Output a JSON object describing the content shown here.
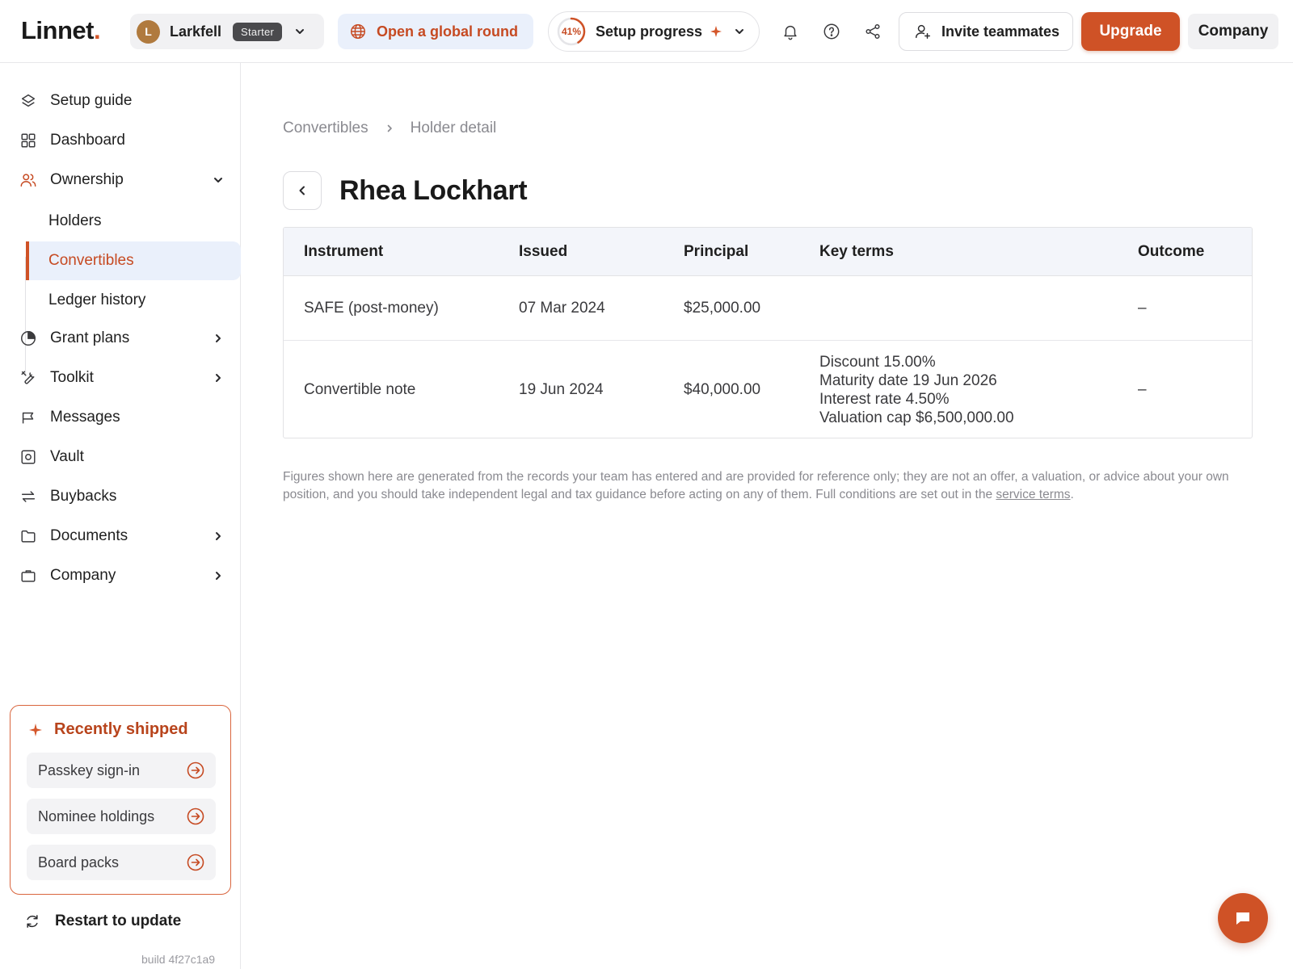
{
  "brand": {
    "name": "Linnet",
    "dot": ".",
    "accent": "#cf5226"
  },
  "header": {
    "org": {
      "initial": "L",
      "name": "Larkfell",
      "plan": "Starter"
    },
    "global_round_label": "Open a global round",
    "setup": {
      "percent_label": "41%",
      "percent": 0.41,
      "label": "Setup progress"
    },
    "invite_label": "Invite teammates",
    "upgrade_label": "Upgrade",
    "company_label": "Company",
    "icons": [
      "bell-icon",
      "help-icon",
      "share-icon"
    ]
  },
  "sidebar": {
    "items": [
      {
        "label": "Setup guide",
        "icon": "setup-guide-icon"
      },
      {
        "label": "Dashboard",
        "icon": "dashboard-icon"
      },
      {
        "label": "Ownership",
        "icon": "people-icon",
        "expanded": true
      },
      {
        "label": "Grant plans",
        "icon": "pie-icon"
      },
      {
        "label": "Toolkit",
        "icon": "tools-icon"
      },
      {
        "label": "Messages",
        "icon": "flag-icon"
      },
      {
        "label": "Vault",
        "icon": "vault-icon"
      },
      {
        "label": "Buybacks",
        "icon": "swap-icon"
      },
      {
        "label": "Documents",
        "icon": "folder-icon"
      },
      {
        "label": "Company",
        "icon": "briefcase-icon"
      }
    ],
    "ownership_children": [
      {
        "label": "Holders"
      },
      {
        "label": "Convertibles",
        "active": true
      },
      {
        "label": "Ledger history"
      }
    ],
    "shipped": {
      "title": "Recently shipped",
      "items": [
        "Passkey sign-in",
        "Nominee holdings",
        "Board packs"
      ]
    },
    "restart_label": "Restart to update",
    "build_label": "build 4f27c1a9"
  },
  "main": {
    "breadcrumb": [
      "Convertibles",
      "Holder detail"
    ],
    "title": "Rhea Lockhart",
    "table": {
      "columns": [
        "Instrument",
        "Issued",
        "Principal",
        "Key terms",
        "Outcome"
      ],
      "rows": [
        {
          "instrument": "SAFE (post-money)",
          "issued": "07 Mar 2024",
          "principal": "$25,000.00",
          "terms": [],
          "outcome": "–"
        },
        {
          "instrument": "Convertible note",
          "issued": "19 Jun 2024",
          "principal": "$40,000.00",
          "terms": [
            "Discount 15.00%",
            "Maturity date 19 Jun 2026",
            "Interest rate 4.50%",
            "Valuation cap $6,500,000.00"
          ],
          "outcome": "–"
        }
      ]
    },
    "disclaimer_text": "Figures shown here are generated from the records your team has entered and are provided for reference only; they are not an offer, a valuation, or advice about your own position, and you should take independent legal and tax guidance before acting on any of them. Full conditions are set out in the ",
    "disclaimer_link": "service terms",
    "disclaimer_end": "."
  }
}
